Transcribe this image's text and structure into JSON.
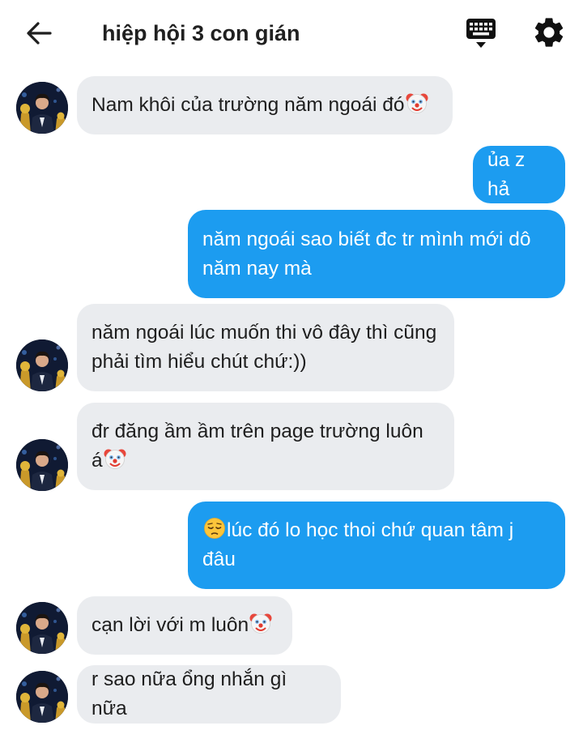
{
  "header": {
    "title": "hiệp hội 3 con gián",
    "back_icon": "arrow-left-icon",
    "keyboard_icon": "keyboard-icon",
    "settings_icon": "gear-icon"
  },
  "colors": {
    "outgoing_bubble": "#1c9cf0",
    "incoming_bubble": "#eaecef"
  },
  "messages": [
    {
      "dir": "in",
      "text": "Nam khôi của trường năm ngoái đó",
      "emoji": "clown-emoji"
    },
    {
      "dir": "out",
      "text": "ủa z hả"
    },
    {
      "dir": "out",
      "text": "năm ngoái sao biết đc tr mình mới dô năm nay mà"
    },
    {
      "dir": "in",
      "text": "năm ngoái lúc muốn thi vô đây thì cũng phải tìm hiểu chút chứ:))"
    },
    {
      "dir": "in",
      "text": "đr đăng ầm ầm trên page trường luôn á",
      "emoji": "clown-emoji"
    },
    {
      "dir": "out",
      "text": "lúc đó lo học thoi chứ quan tâm j đâu",
      "emoji_before": "pensive-emoji"
    },
    {
      "dir": "in",
      "text": "cạn lời với m luôn",
      "emoji": "clown-emoji"
    },
    {
      "dir": "in",
      "text": "r sao nữa ổng nhắn gì nữa"
    }
  ]
}
